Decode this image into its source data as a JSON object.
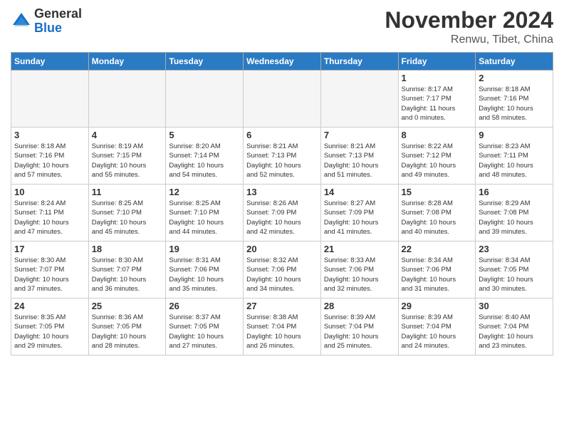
{
  "logo": {
    "general": "General",
    "blue": "Blue"
  },
  "header": {
    "month": "November 2024",
    "location": "Renwu, Tibet, China"
  },
  "weekdays": [
    "Sunday",
    "Monday",
    "Tuesday",
    "Wednesday",
    "Thursday",
    "Friday",
    "Saturday"
  ],
  "weeks": [
    [
      {
        "day": "",
        "info": ""
      },
      {
        "day": "",
        "info": ""
      },
      {
        "day": "",
        "info": ""
      },
      {
        "day": "",
        "info": ""
      },
      {
        "day": "",
        "info": ""
      },
      {
        "day": "1",
        "info": "Sunrise: 8:17 AM\nSunset: 7:17 PM\nDaylight: 11 hours\nand 0 minutes."
      },
      {
        "day": "2",
        "info": "Sunrise: 8:18 AM\nSunset: 7:16 PM\nDaylight: 10 hours\nand 58 minutes."
      }
    ],
    [
      {
        "day": "3",
        "info": "Sunrise: 8:18 AM\nSunset: 7:16 PM\nDaylight: 10 hours\nand 57 minutes."
      },
      {
        "day": "4",
        "info": "Sunrise: 8:19 AM\nSunset: 7:15 PM\nDaylight: 10 hours\nand 55 minutes."
      },
      {
        "day": "5",
        "info": "Sunrise: 8:20 AM\nSunset: 7:14 PM\nDaylight: 10 hours\nand 54 minutes."
      },
      {
        "day": "6",
        "info": "Sunrise: 8:21 AM\nSunset: 7:13 PM\nDaylight: 10 hours\nand 52 minutes."
      },
      {
        "day": "7",
        "info": "Sunrise: 8:21 AM\nSunset: 7:13 PM\nDaylight: 10 hours\nand 51 minutes."
      },
      {
        "day": "8",
        "info": "Sunrise: 8:22 AM\nSunset: 7:12 PM\nDaylight: 10 hours\nand 49 minutes."
      },
      {
        "day": "9",
        "info": "Sunrise: 8:23 AM\nSunset: 7:11 PM\nDaylight: 10 hours\nand 48 minutes."
      }
    ],
    [
      {
        "day": "10",
        "info": "Sunrise: 8:24 AM\nSunset: 7:11 PM\nDaylight: 10 hours\nand 47 minutes."
      },
      {
        "day": "11",
        "info": "Sunrise: 8:25 AM\nSunset: 7:10 PM\nDaylight: 10 hours\nand 45 minutes."
      },
      {
        "day": "12",
        "info": "Sunrise: 8:25 AM\nSunset: 7:10 PM\nDaylight: 10 hours\nand 44 minutes."
      },
      {
        "day": "13",
        "info": "Sunrise: 8:26 AM\nSunset: 7:09 PM\nDaylight: 10 hours\nand 42 minutes."
      },
      {
        "day": "14",
        "info": "Sunrise: 8:27 AM\nSunset: 7:09 PM\nDaylight: 10 hours\nand 41 minutes."
      },
      {
        "day": "15",
        "info": "Sunrise: 8:28 AM\nSunset: 7:08 PM\nDaylight: 10 hours\nand 40 minutes."
      },
      {
        "day": "16",
        "info": "Sunrise: 8:29 AM\nSunset: 7:08 PM\nDaylight: 10 hours\nand 39 minutes."
      }
    ],
    [
      {
        "day": "17",
        "info": "Sunrise: 8:30 AM\nSunset: 7:07 PM\nDaylight: 10 hours\nand 37 minutes."
      },
      {
        "day": "18",
        "info": "Sunrise: 8:30 AM\nSunset: 7:07 PM\nDaylight: 10 hours\nand 36 minutes."
      },
      {
        "day": "19",
        "info": "Sunrise: 8:31 AM\nSunset: 7:06 PM\nDaylight: 10 hours\nand 35 minutes."
      },
      {
        "day": "20",
        "info": "Sunrise: 8:32 AM\nSunset: 7:06 PM\nDaylight: 10 hours\nand 34 minutes."
      },
      {
        "day": "21",
        "info": "Sunrise: 8:33 AM\nSunset: 7:06 PM\nDaylight: 10 hours\nand 32 minutes."
      },
      {
        "day": "22",
        "info": "Sunrise: 8:34 AM\nSunset: 7:06 PM\nDaylight: 10 hours\nand 31 minutes."
      },
      {
        "day": "23",
        "info": "Sunrise: 8:34 AM\nSunset: 7:05 PM\nDaylight: 10 hours\nand 30 minutes."
      }
    ],
    [
      {
        "day": "24",
        "info": "Sunrise: 8:35 AM\nSunset: 7:05 PM\nDaylight: 10 hours\nand 29 minutes."
      },
      {
        "day": "25",
        "info": "Sunrise: 8:36 AM\nSunset: 7:05 PM\nDaylight: 10 hours\nand 28 minutes."
      },
      {
        "day": "26",
        "info": "Sunrise: 8:37 AM\nSunset: 7:05 PM\nDaylight: 10 hours\nand 27 minutes."
      },
      {
        "day": "27",
        "info": "Sunrise: 8:38 AM\nSunset: 7:04 PM\nDaylight: 10 hours\nand 26 minutes."
      },
      {
        "day": "28",
        "info": "Sunrise: 8:39 AM\nSunset: 7:04 PM\nDaylight: 10 hours\nand 25 minutes."
      },
      {
        "day": "29",
        "info": "Sunrise: 8:39 AM\nSunset: 7:04 PM\nDaylight: 10 hours\nand 24 minutes."
      },
      {
        "day": "30",
        "info": "Sunrise: 8:40 AM\nSunset: 7:04 PM\nDaylight: 10 hours\nand 23 minutes."
      }
    ]
  ]
}
